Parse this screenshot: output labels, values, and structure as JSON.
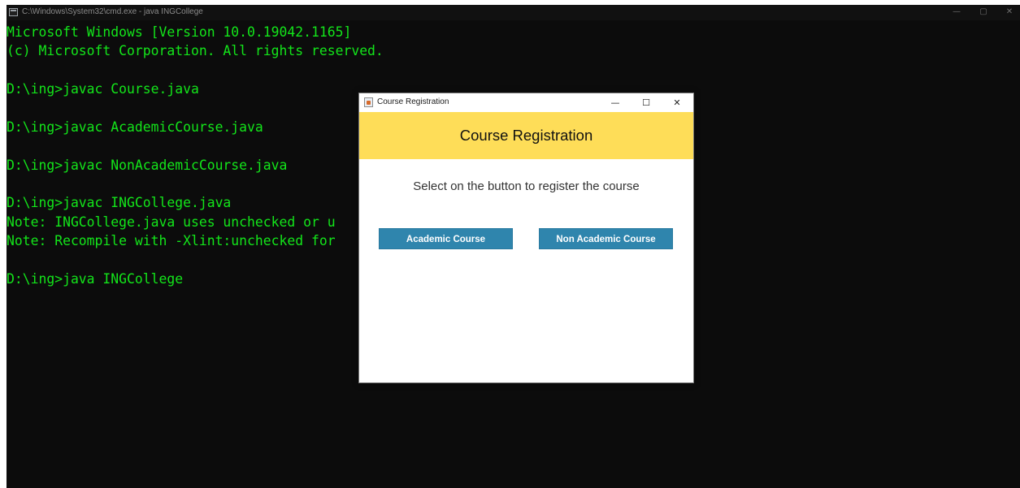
{
  "console_window": {
    "title": "C:\\Windows\\System32\\cmd.exe - java  INGCollege",
    "controls": {
      "minimize": "—",
      "maximize": "▢",
      "close": "✕"
    },
    "text_color": "#13e51a",
    "lines": [
      "Microsoft Windows [Version 10.0.19042.1165]",
      "(c) Microsoft Corporation. All rights reserved.",
      "",
      "D:\\ing>javac Course.java",
      "",
      "D:\\ing>javac AcademicCourse.java",
      "",
      "D:\\ing>javac NonAcademicCourse.java",
      "",
      "D:\\ing>javac INGCollege.java",
      "Note: INGCollege.java uses unchecked or u",
      "Note: Recompile with -Xlint:unchecked for",
      "",
      "D:\\ing>java INGCollege"
    ]
  },
  "dialog": {
    "title": "Course Registration",
    "controls": {
      "minimize": "—",
      "maximize": "☐",
      "close": "✕"
    },
    "header_color": "#fedd58",
    "heading": "Course Registration",
    "instruction": "Select on the button to register the course",
    "button_color": "#2f85ad",
    "buttons": {
      "academic": "Academic Course",
      "non_academic": "Non Academic Course"
    }
  }
}
